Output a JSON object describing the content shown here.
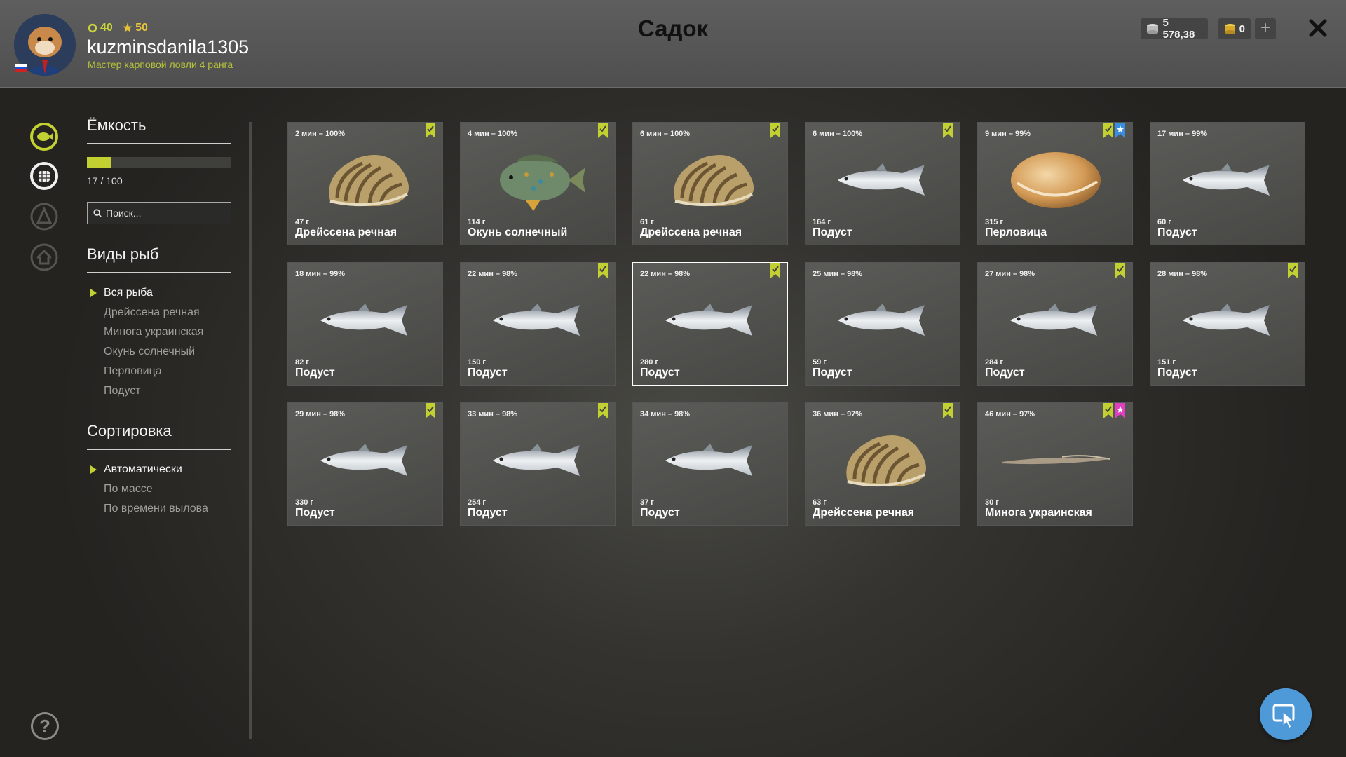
{
  "header": {
    "title": "Садок",
    "username": "kuzminsdanila1305",
    "rank_text": "Мастер карповой ловли 4 ранга",
    "stat_level": "40",
    "stat_stars": "50",
    "silver": "5 578,38",
    "gold": "0",
    "add_label": "+"
  },
  "sidebar": {
    "icons": [
      "fish-icon",
      "keepnet-icon",
      "boat-icon",
      "home-icon"
    ],
    "help_label": "?"
  },
  "panel": {
    "capacity_heading": "Ёмкость",
    "capacity_value": 17,
    "capacity_max": 100,
    "capacity_text": "17 / 100",
    "search_placeholder": "Поиск...",
    "species_heading": "Виды рыб",
    "species": [
      "Вся рыба",
      "Дрейссена речная",
      "Минога украинская",
      "Окунь солнечный",
      "Перловица",
      "Подуст"
    ],
    "species_active": 0,
    "sort_heading": "Сортировка",
    "sort_options": [
      "Автоматически",
      "По массе",
      "По времени вылова"
    ],
    "sort_active": 0
  },
  "colors": {
    "accent": "#c2d032",
    "badge_blue": "#3a8ee0",
    "badge_pink": "#e040c0",
    "fab": "#4e99d8"
  },
  "catches": [
    {
      "time": "2 мин – 100%",
      "weight": "47 г",
      "name": "Дрейссена речная",
      "kind": "mussel",
      "badges": [
        "green"
      ]
    },
    {
      "time": "4 мин – 100%",
      "weight": "114 г",
      "name": "Окунь солнечный",
      "kind": "sunfish",
      "badges": [
        "green"
      ]
    },
    {
      "time": "6 мин – 100%",
      "weight": "61 г",
      "name": "Дрейссена речная",
      "kind": "mussel",
      "badges": [
        "green"
      ]
    },
    {
      "time": "6 мин – 100%",
      "weight": "164 г",
      "name": "Подуст",
      "kind": "fish",
      "badges": [
        "green"
      ]
    },
    {
      "time": "9 мин – 99%",
      "weight": "315 г",
      "name": "Перловица",
      "kind": "clam",
      "badges": [
        "green",
        "blue"
      ]
    },
    {
      "time": "17 мин – 99%",
      "weight": "60 г",
      "name": "Подуст",
      "kind": "fish",
      "badges": []
    },
    {
      "time": "18 мин – 99%",
      "weight": "82 г",
      "name": "Подуст",
      "kind": "fish",
      "badges": []
    },
    {
      "time": "22 мин – 98%",
      "weight": "150 г",
      "name": "Подуст",
      "kind": "fish",
      "badges": [
        "green"
      ]
    },
    {
      "time": "22 мин – 98%",
      "weight": "280 г",
      "name": "Подуст",
      "kind": "fish",
      "badges": [
        "green"
      ],
      "selected": true
    },
    {
      "time": "25 мин – 98%",
      "weight": "59 г",
      "name": "Подуст",
      "kind": "fish",
      "badges": []
    },
    {
      "time": "27 мин – 98%",
      "weight": "284 г",
      "name": "Подуст",
      "kind": "fish",
      "badges": [
        "green"
      ]
    },
    {
      "time": "28 мин – 98%",
      "weight": "151 г",
      "name": "Подуст",
      "kind": "fish",
      "badges": [
        "green"
      ]
    },
    {
      "time": "29 мин – 98%",
      "weight": "330 г",
      "name": "Подуст",
      "kind": "fish",
      "badges": [
        "green"
      ]
    },
    {
      "time": "33 мин – 98%",
      "weight": "254 г",
      "name": "Подуст",
      "kind": "fish",
      "badges": [
        "green"
      ]
    },
    {
      "time": "34 мин – 98%",
      "weight": "37 г",
      "name": "Подуст",
      "kind": "fish",
      "badges": []
    },
    {
      "time": "36 мин – 97%",
      "weight": "63 г",
      "name": "Дрейссена речная",
      "kind": "mussel",
      "badges": [
        "green"
      ]
    },
    {
      "time": "46 мин – 97%",
      "weight": "30 г",
      "name": "Минога украинская",
      "kind": "lamprey",
      "badges": [
        "green",
        "pink"
      ]
    }
  ]
}
